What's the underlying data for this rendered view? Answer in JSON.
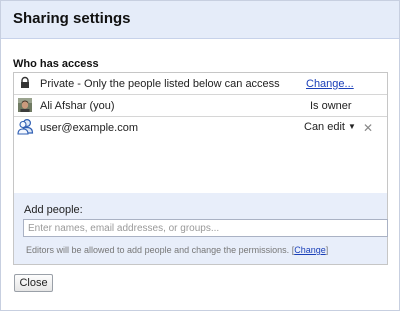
{
  "dialog": {
    "title": "Sharing settings",
    "section_label": "Who has access",
    "visibility": {
      "text": "Private - Only the people listed below can access",
      "change_label": "Change..."
    },
    "people": [
      {
        "name": "Ali Afshar (you)",
        "role": "Is owner"
      },
      {
        "name": "user@example.com",
        "role": "Can edit"
      }
    ],
    "add_people": {
      "label": "Add people:",
      "placeholder": "Enter names, email addresses, or groups...",
      "note_text": "Editors will be allowed to add people and change the permissions.",
      "note_open": "[",
      "note_link": "Change",
      "note_close": "]"
    },
    "close_label": "Close"
  },
  "icons": {
    "lock": "lock-icon",
    "avatar": "avatar",
    "contact": "contact-icon",
    "dropdown": "chevron-down-icon",
    "remove": "close-icon"
  },
  "colors": {
    "titlebar": "#e5ecf9",
    "add_area": "#e8eefa",
    "link": "#1a3fb8"
  }
}
